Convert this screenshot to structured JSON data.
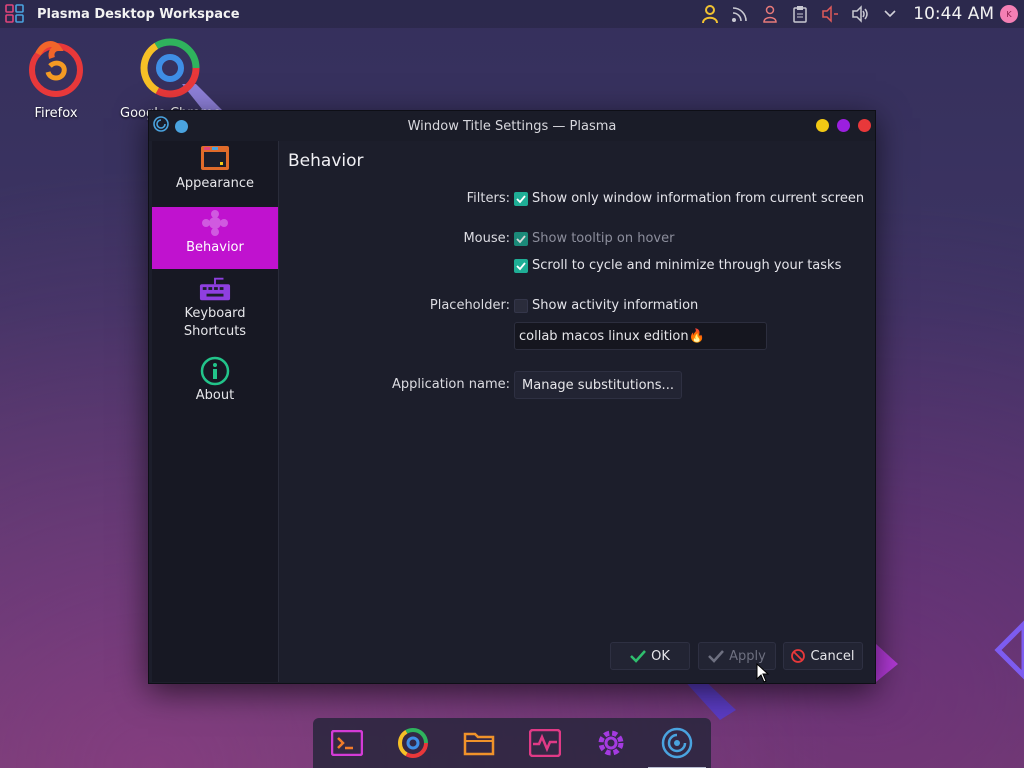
{
  "panel": {
    "title": "Plasma Desktop Workspace",
    "clock": "10:44 AM",
    "tray_icons": [
      "user-icon",
      "rss-icon",
      "person-icon",
      "clipboard-icon",
      "mute-icon",
      "volume-icon",
      "chevron-down-icon"
    ],
    "avatar_letter": "K"
  },
  "desktop": {
    "icons": [
      {
        "label": "Firefox",
        "icon": "firefox-icon"
      },
      {
        "label": "Google Chrome",
        "icon": "chrome-icon"
      }
    ]
  },
  "window": {
    "title": "Window Title Settings — Plasma",
    "sidebar": {
      "items": [
        {
          "label": "Appearance",
          "icon": "appearance-icon",
          "active": false
        },
        {
          "label": "Behavior",
          "icon": "behavior-icon",
          "active": true
        },
        {
          "label": "Keyboard Shortcuts",
          "icon": "keyboard-icon",
          "active": false
        },
        {
          "label": "About",
          "icon": "info-icon",
          "active": false
        }
      ]
    },
    "page_title": "Behavior",
    "form": {
      "filters_label": "Filters:",
      "filters_option": "Show only window information from current screen",
      "filters_checked": true,
      "mouse_label": "Mouse:",
      "tooltip_option": "Show tooltip on hover",
      "tooltip_checked": true,
      "scroll_option": "Scroll to cycle and minimize through your tasks",
      "scroll_checked": true,
      "placeholder_label": "Placeholder:",
      "activity_option": "Show activity information",
      "activity_checked": false,
      "placeholder_value": "collab macos linux edition🔥",
      "appname_label": "Application name:",
      "manage_button": "Manage substitutions..."
    },
    "buttons": {
      "ok": "OK",
      "apply": "Apply",
      "cancel": "Cancel"
    }
  },
  "dock": {
    "items": [
      "terminal-icon",
      "chrome-icon",
      "folder-icon",
      "system-monitor-icon",
      "settings-icon",
      "plasma-settings-icon"
    ]
  },
  "colors": {
    "accent": "#c012cf",
    "checkbox": "#1fae96",
    "window_bg": "#1c1e2b"
  }
}
